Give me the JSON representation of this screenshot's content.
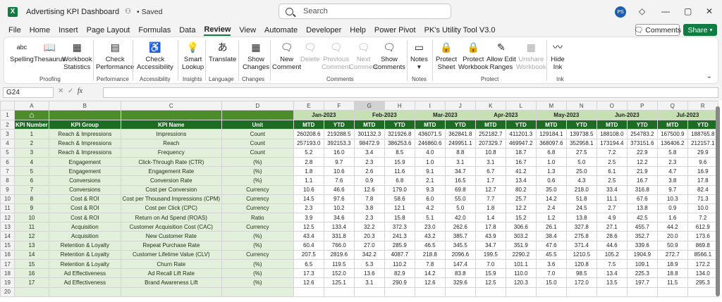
{
  "titlebar": {
    "logo": "X",
    "doc_title": "Advertising KPI Dashboard",
    "saved": "• Saved",
    "search_placeholder": "Search",
    "avatar": "PS"
  },
  "menu": [
    "File",
    "Home",
    "Insert",
    "Page Layout",
    "Formulas",
    "Data",
    "Review",
    "View",
    "Automate",
    "Developer",
    "Help",
    "Power Pivot",
    "PK's Utility Tool V3.0"
  ],
  "active_menu": "Review",
  "buttons": {
    "comments": "Comments",
    "share": "Share"
  },
  "ribbon": {
    "spelling": "Spelling",
    "spelling_icon_text": "abc",
    "thesaurus": "Thesaurus",
    "workbook_statistics_1": "Workbook",
    "workbook_statistics_2": "Statistics",
    "check_performance_1": "Check",
    "check_performance_2": "Performance",
    "check_accessibility_1": "Check",
    "check_accessibility_2": "Accessibility",
    "smart_lookup_1": "Smart",
    "smart_lookup_2": "Lookup",
    "translate": "Translate",
    "show_changes_1": "Show",
    "show_changes_2": "Changes",
    "new_comment_1": "New",
    "new_comment_2": "Comment",
    "delete": "Delete",
    "previous_comment_1": "Previous",
    "previous_comment_2": "Comment",
    "next_comment_1": "Next",
    "next_comment_2": "Comment",
    "show_comments_1": "Show",
    "show_comments_2": "Comments",
    "notes": "Notes",
    "protect_sheet_1": "Protect",
    "protect_sheet_2": "Sheet",
    "protect_workbook_1": "Protect",
    "protect_workbook_2": "Workbook",
    "allow_edit_ranges_1": "Allow Edit",
    "allow_edit_ranges_2": "Ranges",
    "unshare_workbook_1": "Unshare",
    "unshare_workbook_2": "Workbook",
    "hide_ink_1": "Hide",
    "hide_ink_2": "Ink",
    "groups": {
      "proofing": "Proofing",
      "performance": "Performance",
      "accessibility": "Accessibility",
      "insights": "Insights",
      "language": "Language",
      "changes": "Changes",
      "comments": "Comments",
      "notes": "Notes",
      "protect": "Protect",
      "ink": "Ink"
    }
  },
  "namebox": "G24",
  "columns": [
    "A",
    "B",
    "C",
    "D",
    "E",
    "F",
    "G",
    "H",
    "I",
    "J",
    "K",
    "L",
    "M",
    "N",
    "O",
    "P",
    "Q",
    "R"
  ],
  "selected_column": "G",
  "row_numbers": [
    "1",
    "2",
    "3",
    "4",
    "5",
    "6",
    "7",
    "8",
    "9",
    "10",
    "11",
    "12",
    "13",
    "14",
    "15",
    "16",
    "17",
    "18",
    "19",
    "20"
  ],
  "months": [
    "Jan-2023",
    "Feb-2023",
    "Mar-2023",
    "Apr-2023",
    "May-2023",
    "Jun-2023",
    "Jul-2023"
  ],
  "headers": {
    "kpi_number": "KPI Number",
    "kpi_group": "KPI Group",
    "kpi_name": "KPI Name",
    "unit": "Unit",
    "mtd": "MTD",
    "ytd": "YTD"
  },
  "rows": [
    {
      "num": "1",
      "group": "Reach & Impressions",
      "name": "Impressions",
      "unit": "Count",
      "vals": [
        "260208.6",
        "219288.5",
        "301132.3",
        "321926.8",
        "436071.5",
        "362841.8",
        "252182.7",
        "411201.3",
        "129184.1",
        "139738.5",
        "188108.0",
        "254783.2",
        "167500.9",
        "188765.8"
      ]
    },
    {
      "num": "2",
      "group": "Reach & Impressions",
      "name": "Reach",
      "unit": "Count",
      "vals": [
        "257193.0",
        "392153.3",
        "98472.9",
        "386253.6",
        "246860.6",
        "249951.1",
        "207329.7",
        "469947.2",
        "368097.6",
        "352958.1",
        "173194.4",
        "373151.6",
        "136406.2",
        "212157.1"
      ]
    },
    {
      "num": "3",
      "group": "Reach & Impressions",
      "name": "Frequency",
      "unit": "Count",
      "vals": [
        "5.2",
        "16.0",
        "3.4",
        "8.5",
        "4.0",
        "8.8",
        "10.8",
        "18.7",
        "6.8",
        "27.5",
        "7.2",
        "22.9",
        "5.8",
        "29.9"
      ]
    },
    {
      "num": "4",
      "group": "Engagement",
      "name": "Click-Through Rate (CTR)",
      "unit": "(%)",
      "vals": [
        "2.8",
        "9.7",
        "2.3",
        "15.9",
        "1.0",
        "3.1",
        "3.1",
        "16.7",
        "1.0",
        "5.0",
        "2.5",
        "12.2",
        "2.3",
        "9.6"
      ]
    },
    {
      "num": "5",
      "group": "Engagement",
      "name": "Engagement Rate",
      "unit": "(%)",
      "vals": [
        "1.8",
        "10.6",
        "2.6",
        "11.6",
        "9.1",
        "34.7",
        "6.7",
        "41.2",
        "1.3",
        "25.0",
        "6.1",
        "21.9",
        "4.7",
        "16.9"
      ]
    },
    {
      "num": "6",
      "group": "Conversions",
      "name": "Conversion Rate",
      "unit": "(%)",
      "vals": [
        "1.1",
        "7.6",
        "0.9",
        "6.8",
        "2.1",
        "16.5",
        "1.7",
        "13.4",
        "0.6",
        "4.3",
        "2.5",
        "16.7",
        "3.8",
        "17.8"
      ]
    },
    {
      "num": "7",
      "group": "Conversions",
      "name": "Cost per Conversion",
      "unit": "Currency",
      "vals": [
        "10.6",
        "46.6",
        "12.6",
        "179.0",
        "9.3",
        "69.8",
        "12.7",
        "80.2",
        "35.0",
        "218.0",
        "33.4",
        "316.8",
        "9.7",
        "82.4"
      ]
    },
    {
      "num": "8",
      "group": "Cost & ROI",
      "name": "Cost per Thousand Impressions (CPM)",
      "unit": "Currency",
      "vals": [
        "14.5",
        "97.6",
        "7.8",
        "58.6",
        "6.0",
        "55.0",
        "7.7",
        "25.7",
        "14.2",
        "51.8",
        "11.1",
        "67.6",
        "10.3",
        "71.3"
      ]
    },
    {
      "num": "9",
      "group": "Cost & ROI",
      "name": "Cost per Click (CPC)",
      "unit": "Currency",
      "vals": [
        "2.3",
        "10.2",
        "3.8",
        "12.1",
        "4.2",
        "5.0",
        "1.8",
        "12.2",
        "2.4",
        "24.5",
        "2.7",
        "13.8",
        "0.9",
        "10.0"
      ]
    },
    {
      "num": "10",
      "group": "Cost & ROI",
      "name": "Return on Ad Spend (ROAS)",
      "unit": "Ratio",
      "vals": [
        "3.9",
        "34.6",
        "2.3",
        "15.8",
        "5.1",
        "42.0",
        "1.4",
        "15.2",
        "1.2",
        "13.8",
        "4.9",
        "42.5",
        "1.6",
        "7.2"
      ]
    },
    {
      "num": "11",
      "group": "Acquisition",
      "name": "Customer Acquisition Cost (CAC)",
      "unit": "Currency",
      "vals": [
        "12.5",
        "133.4",
        "32.2",
        "372.3",
        "23.0",
        "262.6",
        "17.8",
        "306.6",
        "26.1",
        "327.8",
        "27.1",
        "455.7",
        "44.2",
        "612.9"
      ]
    },
    {
      "num": "12",
      "group": "Acquisition",
      "name": "New Customer Rate",
      "unit": "(%)",
      "vals": [
        "43.4",
        "331.8",
        "20.3",
        "241.3",
        "43.2",
        "385.7",
        "43.9",
        "303.2",
        "38.4",
        "275.8",
        "28.6",
        "352.7",
        "20.0",
        "173.6"
      ]
    },
    {
      "num": "13",
      "group": "Retention & Loyalty",
      "name": "Repeat Purchase Rate",
      "unit": "(%)",
      "vals": [
        "60.4",
        "766.0",
        "27.0",
        "285.9",
        "46.5",
        "345.5",
        "34.7",
        "351.9",
        "47.6",
        "371.4",
        "44.6",
        "339.6",
        "50.9",
        "869.8"
      ]
    },
    {
      "num": "14",
      "group": "Retention & Loyalty",
      "name": "Customer Lifetime Value (CLV)",
      "unit": "Currency",
      "vals": [
        "207.5",
        "2819.6",
        "342.2",
        "4087.7",
        "218.8",
        "2096.6",
        "199.5",
        "2290.2",
        "45.5",
        "1210.5",
        "105.2",
        "1904.9",
        "272.7",
        "8566.1"
      ]
    },
    {
      "num": "15",
      "group": "Retention & Loyalty",
      "name": "Churn Rate",
      "unit": "(%)",
      "vals": [
        "6.5",
        "119.5",
        "5.3",
        "110.2",
        "7.8",
        "147.4",
        "7.0",
        "101.1",
        "3.6",
        "120.8",
        "7.5",
        "109.1",
        "18.9",
        "172.2"
      ]
    },
    {
      "num": "16",
      "group": "Ad Effectiveness",
      "name": "Ad Recall Lift Rate",
      "unit": "(%)",
      "vals": [
        "17.3",
        "152.0",
        "13.6",
        "82.9",
        "14.2",
        "83.8",
        "15.9",
        "110.0",
        "7.0",
        "98.5",
        "13.4",
        "225.3",
        "18.8",
        "134.0"
      ]
    },
    {
      "num": "17",
      "group": "Ad Effectiveness",
      "name": "Brand Awareness Lift",
      "unit": "(%)",
      "vals": [
        "12.6",
        "125.1",
        "3.1",
        "290.9",
        "12.6",
        "329.6",
        "12.5",
        "120.3",
        "15.0",
        "172.0",
        "13.5",
        "197.7",
        "11.5",
        "295.3"
      ]
    }
  ]
}
